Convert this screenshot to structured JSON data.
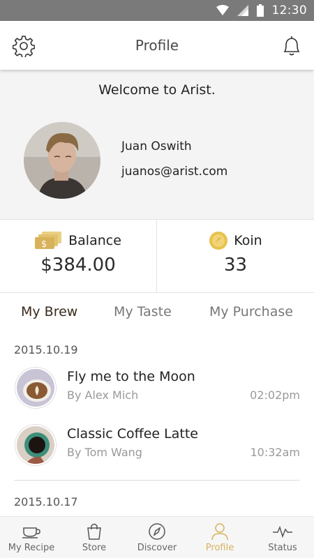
{
  "status_bar": {
    "time": "12:30",
    "icons": [
      "wifi-icon",
      "signal-icon",
      "battery-icon"
    ]
  },
  "header": {
    "title": "Profile",
    "left_icon": "gear-icon",
    "right_icon": "bell-icon"
  },
  "profile": {
    "welcome": "Welcome to Arist.",
    "name": "Juan Oswith",
    "email": "juanos@arist.com"
  },
  "stats": {
    "balance": {
      "label": "Balance",
      "value": "$384.00",
      "icon": "money-icon"
    },
    "koin": {
      "label": "Koin",
      "value": "33",
      "icon": "coin-icon"
    }
  },
  "tabs": [
    {
      "label": "My Brew",
      "active": true
    },
    {
      "label": "My Taste",
      "active": false
    },
    {
      "label": "My Purchase",
      "active": false
    }
  ],
  "groups": [
    {
      "date": "2015.10.19",
      "items": [
        {
          "title": "Fly me to the Moon",
          "author": "By Alex Mich",
          "time": "02:02pm"
        },
        {
          "title": "Classic Coffee Latte",
          "author": "By Tom Wang",
          "time": "10:32am"
        }
      ]
    },
    {
      "date": "2015.10.17",
      "items": []
    }
  ],
  "bottom_nav": [
    {
      "label": "My Recipe",
      "icon": "cup-icon",
      "active": false
    },
    {
      "label": "Store",
      "icon": "bag-icon",
      "active": false
    },
    {
      "label": "Discover",
      "icon": "compass-icon",
      "active": false
    },
    {
      "label": "Profile",
      "icon": "person-icon",
      "active": true
    },
    {
      "label": "Status",
      "icon": "pulse-icon",
      "active": false
    }
  ],
  "colors": {
    "accent": "#d8b25b",
    "active_tab": "#3a2a1c",
    "status_bar": "#7a7a7a",
    "profile_bg": "#f4f4f4"
  }
}
